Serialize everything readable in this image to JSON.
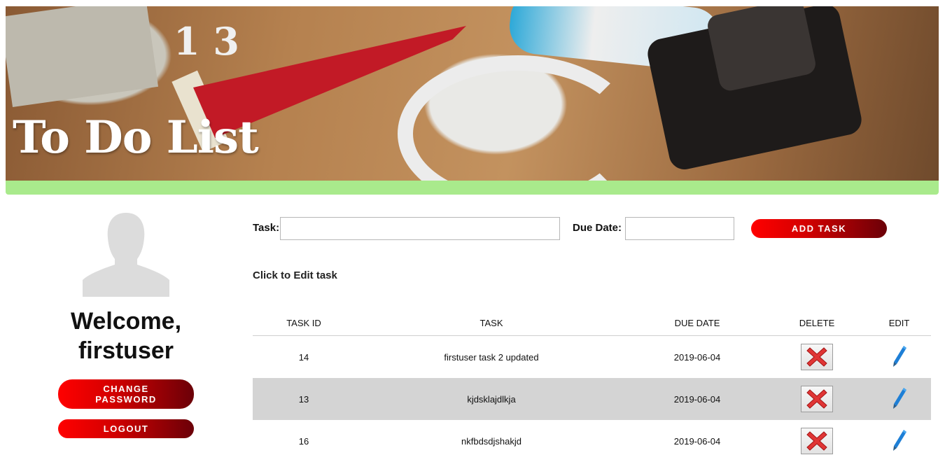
{
  "header": {
    "title": "To Do List",
    "banner_numbers": "1 3",
    "accent_color": "#a9ea8c"
  },
  "sidebar": {
    "avatar_icon": "user-silhouette-icon",
    "welcome_line1": "Welcome,",
    "username": "firstuser",
    "change_password_line1": "CHANGE",
    "change_password_line2": "PASSWORD",
    "logout_label": "LOGOUT"
  },
  "form": {
    "task_label": "Task:",
    "task_value": "",
    "due_date_label": "Due Date:",
    "due_date_value": "",
    "add_button_label": "ADD TASK"
  },
  "hint": "Click to Edit task",
  "table": {
    "columns": [
      "TASK ID",
      "TASK",
      "DUE DATE",
      "DELETE",
      "EDIT"
    ],
    "rows": [
      {
        "id": "14",
        "task": "firstuser task 2 updated",
        "due_date": "2019-06-04"
      },
      {
        "id": "13",
        "task": "kjdsklajdlkja",
        "due_date": "2019-06-04"
      },
      {
        "id": "16",
        "task": "nkfbdsdjshakjd",
        "due_date": "2019-06-04"
      }
    ],
    "delete_icon": "red-x-icon",
    "edit_icon": "pencil-icon"
  },
  "colors": {
    "button_gradient_start": "#ff0000",
    "button_gradient_end": "#6b0008",
    "alt_row": "#d4d4d4"
  }
}
